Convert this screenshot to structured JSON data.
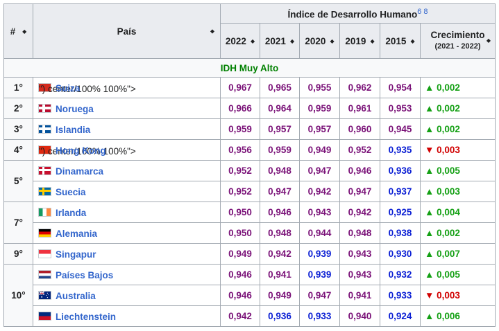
{
  "table": {
    "rank_header": "#",
    "country_header": "País",
    "group_header": "Índice de Desarrollo Humano",
    "group_refs": "6 8",
    "years": [
      "2022",
      "2021",
      "2020",
      "2019",
      "2015"
    ],
    "growth_header": "Crecimiento",
    "growth_sub": "(2021 - 2022)",
    "sort_glyph": "◆",
    "band_label": "IDH Muy Alto",
    "colors": {
      "purple": "#7a1278",
      "blue": "#0b1fd4",
      "up": "#14a014",
      "down": "#d10000",
      "link": "#3366cc",
      "band_text": "#008000"
    },
    "rows": [
      {
        "rank": "1°",
        "country": "Suiza",
        "flag": "flag-switzerland-icon",
        "values": [
          "0,967",
          "0,965",
          "0,955",
          "0,962",
          "0,954"
        ],
        "tones": [
          "p",
          "p",
          "p",
          "p",
          "p"
        ],
        "arrow": "▲",
        "dir": "up",
        "growth": "0,002"
      },
      {
        "rank": "2°",
        "country": "Noruega",
        "flag": "flag-norway-icon",
        "values": [
          "0,966",
          "0,964",
          "0,959",
          "0,961",
          "0,953"
        ],
        "tones": [
          "p",
          "p",
          "p",
          "p",
          "p"
        ],
        "arrow": "▲",
        "dir": "up",
        "growth": "0,002"
      },
      {
        "rank": "3°",
        "country": "Islandia",
        "flag": "flag-iceland-icon",
        "values": [
          "0,959",
          "0,957",
          "0,957",
          "0,960",
          "0,945"
        ],
        "tones": [
          "p",
          "p",
          "p",
          "p",
          "p"
        ],
        "arrow": "▲",
        "dir": "up",
        "growth": "0,002"
      },
      {
        "rank": "4°",
        "country": "Hong Kong",
        "flag": "flag-hong-kong-icon",
        "values": [
          "0,956",
          "0,959",
          "0,949",
          "0,952",
          "0,935"
        ],
        "tones": [
          "p",
          "p",
          "p",
          "p",
          "b"
        ],
        "arrow": "▼",
        "dir": "down",
        "growth": "0,003"
      },
      {
        "rank": "5°",
        "country": "Dinamarca",
        "flag": "flag-denmark-icon",
        "values": [
          "0,952",
          "0,948",
          "0,947",
          "0,946",
          "0,936"
        ],
        "tones": [
          "p",
          "p",
          "p",
          "p",
          "b"
        ],
        "arrow": "▲",
        "dir": "up",
        "growth": "0,005"
      },
      {
        "rank": "",
        "country": "Suecia",
        "flag": "flag-sweden-icon",
        "values": [
          "0,952",
          "0,947",
          "0,942",
          "0,947",
          "0,937"
        ],
        "tones": [
          "p",
          "p",
          "p",
          "p",
          "b"
        ],
        "arrow": "▲",
        "dir": "up",
        "growth": "0,003"
      },
      {
        "rank": "7°",
        "country": "Irlanda",
        "flag": "flag-ireland-icon",
        "values": [
          "0,950",
          "0,946",
          "0,943",
          "0,942",
          "0,925"
        ],
        "tones": [
          "p",
          "p",
          "p",
          "p",
          "b"
        ],
        "arrow": "▲",
        "dir": "up",
        "growth": "0,004"
      },
      {
        "rank": "",
        "country": "Alemania",
        "flag": "flag-germany-icon",
        "values": [
          "0,950",
          "0,948",
          "0,944",
          "0,948",
          "0,938"
        ],
        "tones": [
          "p",
          "p",
          "p",
          "p",
          "b"
        ],
        "arrow": "▲",
        "dir": "up",
        "growth": "0,002"
      },
      {
        "rank": "9°",
        "country": "Singapur",
        "flag": "flag-singapore-icon",
        "values": [
          "0,949",
          "0,942",
          "0,939",
          "0,943",
          "0,930"
        ],
        "tones": [
          "p",
          "p",
          "b",
          "p",
          "b"
        ],
        "arrow": "▲",
        "dir": "up",
        "growth": "0,007"
      },
      {
        "rank": "10°",
        "country": "Países Bajos",
        "flag": "flag-netherlands-icon",
        "values": [
          "0,946",
          "0,941",
          "0,939",
          "0,943",
          "0,932"
        ],
        "tones": [
          "p",
          "p",
          "b",
          "p",
          "b"
        ],
        "arrow": "▲",
        "dir": "up",
        "growth": "0,005"
      },
      {
        "rank": "",
        "country": "Australia",
        "flag": "flag-australia-icon",
        "values": [
          "0,946",
          "0,949",
          "0,947",
          "0,941",
          "0,933"
        ],
        "tones": [
          "p",
          "p",
          "p",
          "p",
          "b"
        ],
        "arrow": "▼",
        "dir": "down",
        "growth": "0,003"
      },
      {
        "rank": "",
        "country": "Liechtenstein",
        "flag": "flag-liechtenstein-icon",
        "values": [
          "0,942",
          "0,936",
          "0,933",
          "0,940",
          "0,924"
        ],
        "tones": [
          "p",
          "b",
          "b",
          "p",
          "b"
        ],
        "arrow": "▲",
        "dir": "up",
        "growth": "0,006"
      }
    ]
  }
}
